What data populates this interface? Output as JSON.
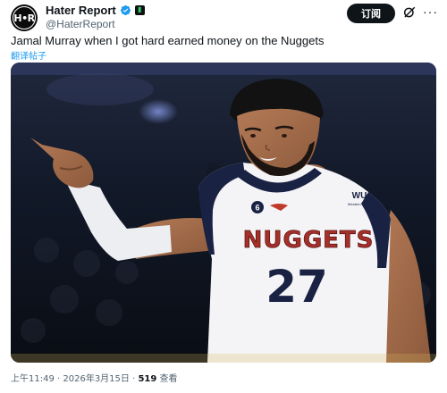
{
  "account": {
    "avatar_text": "H•R",
    "display_name": "Hater Report",
    "handle": "@HaterReport"
  },
  "actions": {
    "subscribe_label": "订阅"
  },
  "tweet": {
    "text": "Jamal Murray when I got hard earned money on the Nuggets",
    "translate_label": "翻译帖子"
  },
  "media": {
    "jersey_team": "NUGGETS",
    "jersey_number": "27",
    "sponsor_logo": "WU",
    "sponsor_name": "Western Union",
    "nba_patch_number": "6"
  },
  "meta": {
    "time": "上午11:49",
    "separator1": " · ",
    "date": "2026年3月15日",
    "separator2": " · ",
    "views_count": "519",
    "views_label": " 查看"
  },
  "colors": {
    "verified_blue": "#1d9bf0",
    "jersey_red": "#a72f2a",
    "jersey_navy": "#1a2244",
    "subscribe_bg": "#0f1419"
  },
  "icons": {
    "verified": "verified-badge-icon",
    "affiliate": "affiliate-badge-icon",
    "grok": "grok-icon",
    "more": "more-options-icon"
  }
}
